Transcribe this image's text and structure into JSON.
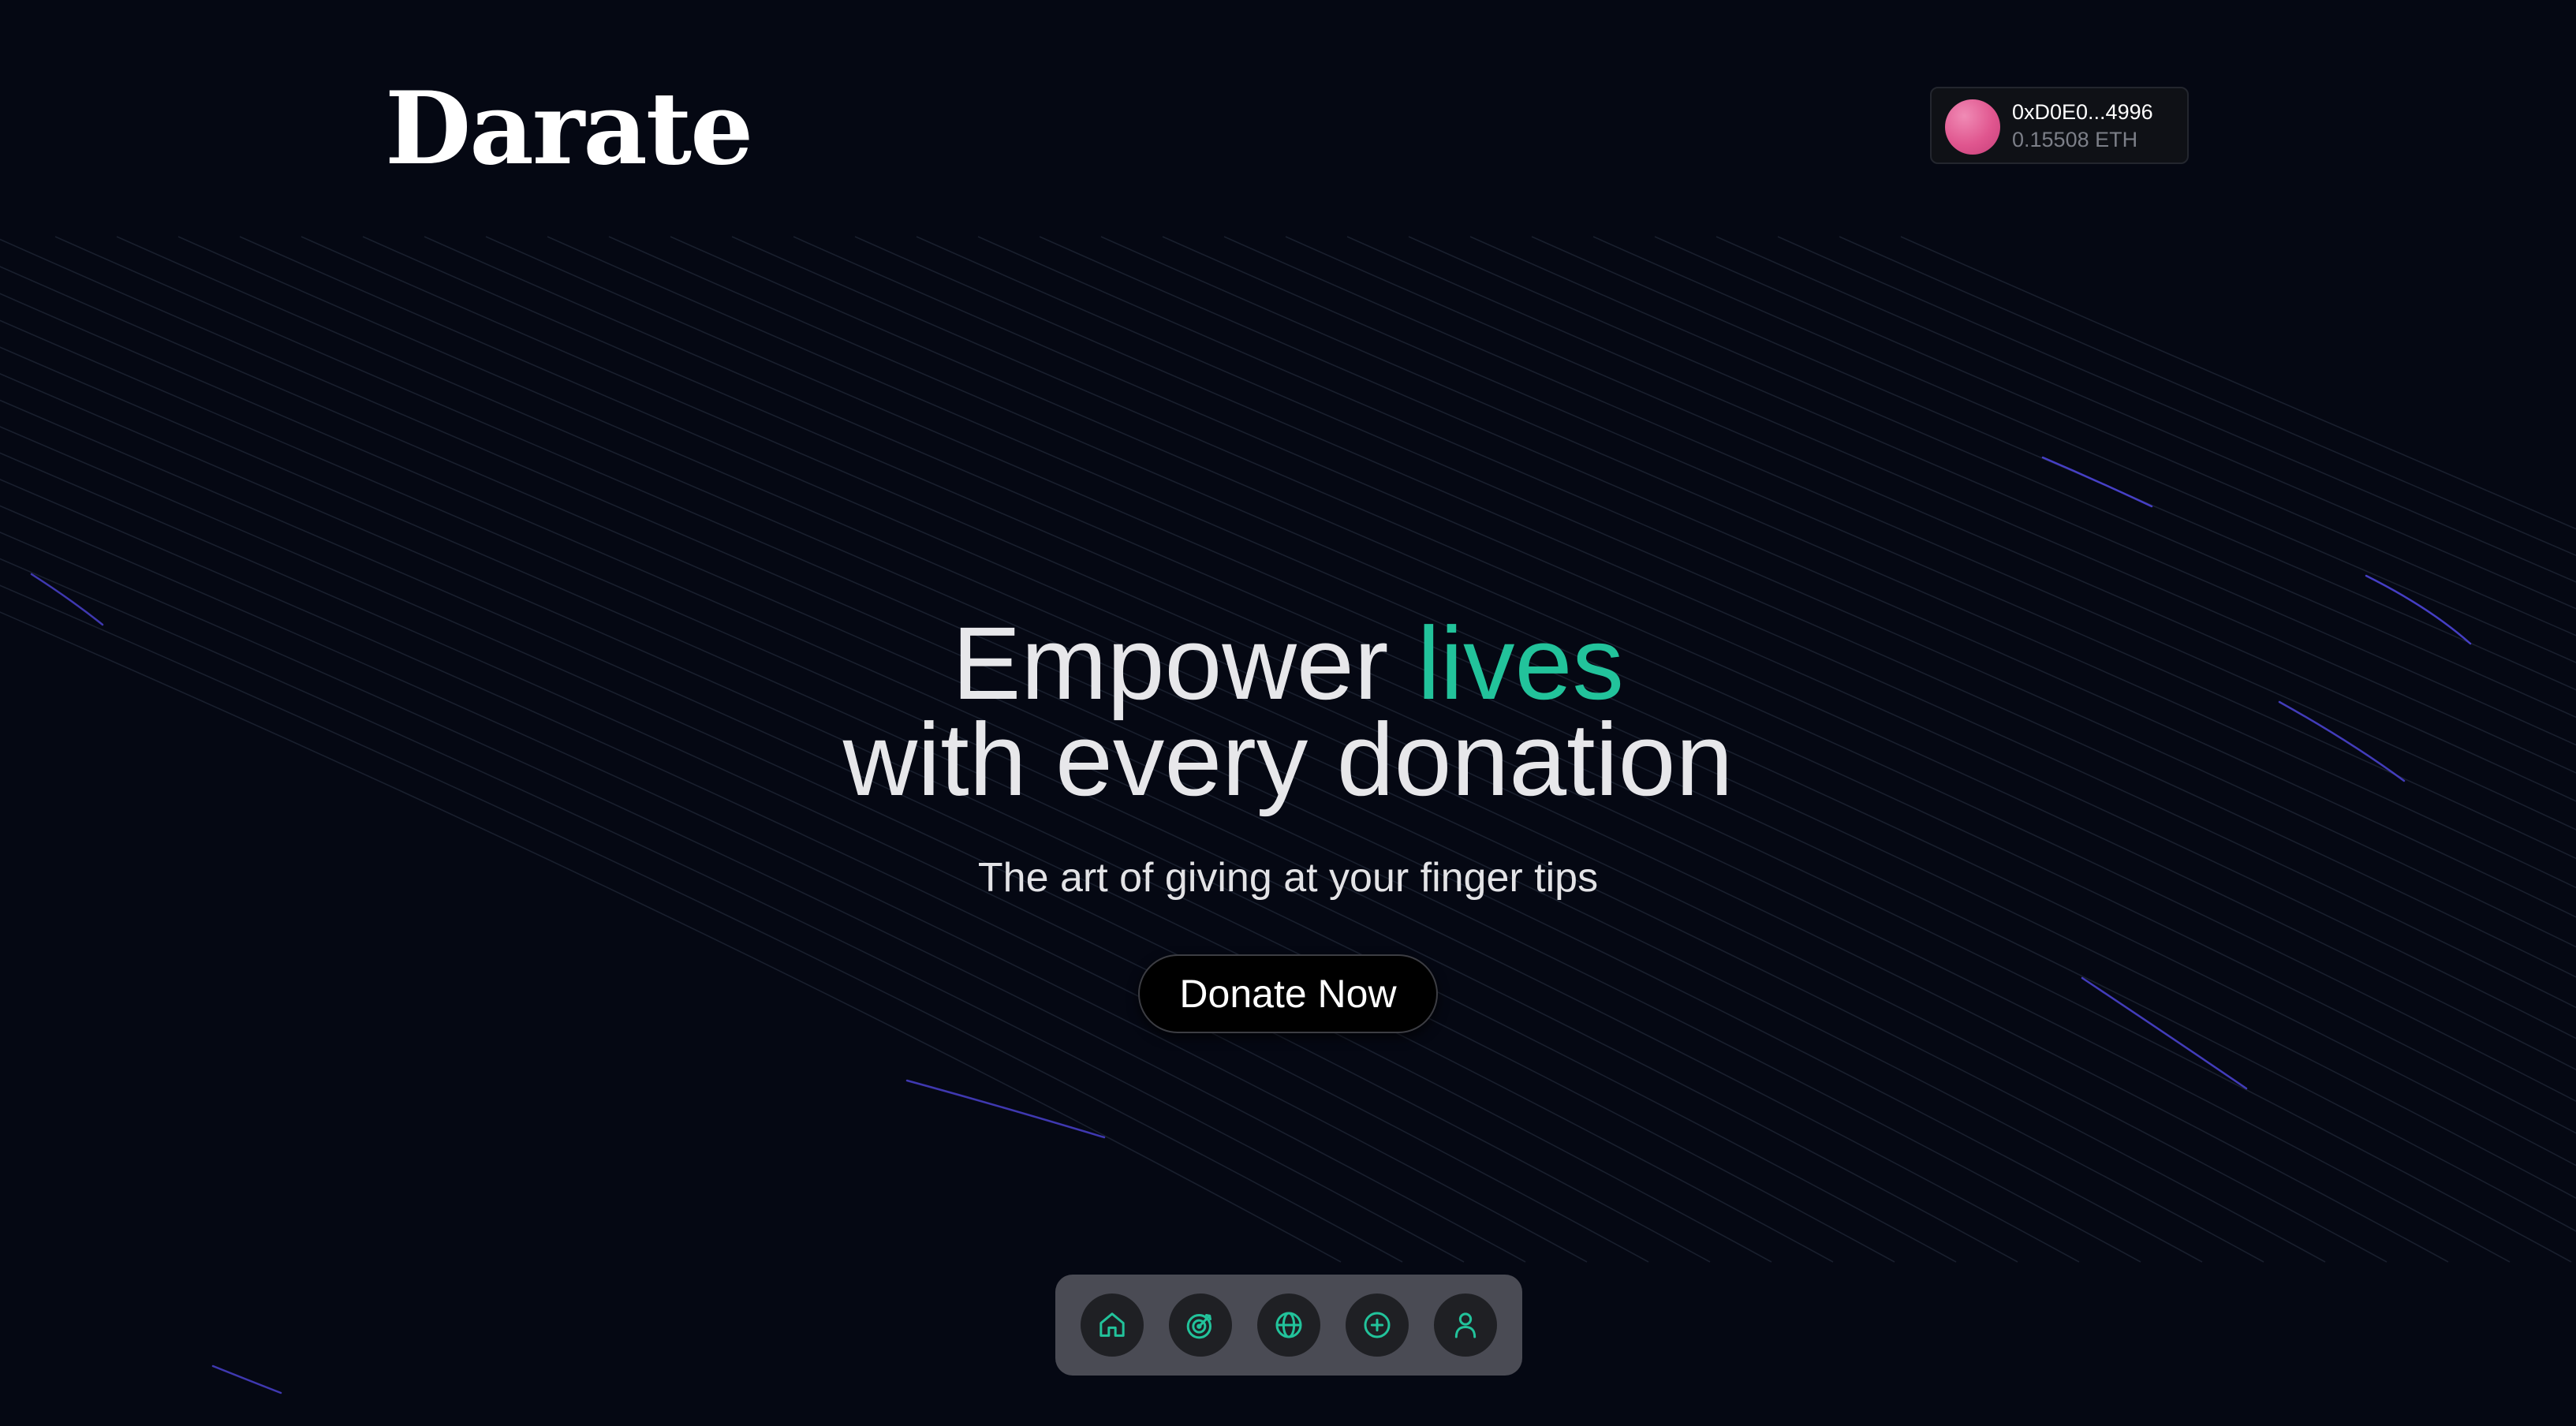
{
  "brand": {
    "name": "Darate"
  },
  "wallet": {
    "address": "0xD0E0...4996",
    "balance": "0.15508 ETH"
  },
  "hero": {
    "line1_prefix": "Empower ",
    "line1_accent": "lives",
    "line2": "with every donation",
    "subtitle": "The art of giving at your finger tips",
    "cta_label": "Donate Now"
  },
  "bottom_nav": {
    "items": [
      {
        "icon": "home-icon"
      },
      {
        "icon": "target-icon"
      },
      {
        "icon": "globe-icon"
      },
      {
        "icon": "plus-circle-icon"
      },
      {
        "icon": "user-icon"
      }
    ]
  },
  "colors": {
    "background": "#050813",
    "accent": "#22c39b",
    "nav_background": "#4a4b54",
    "avatar": "#e0568f",
    "streaks": "#5b4ee6"
  }
}
